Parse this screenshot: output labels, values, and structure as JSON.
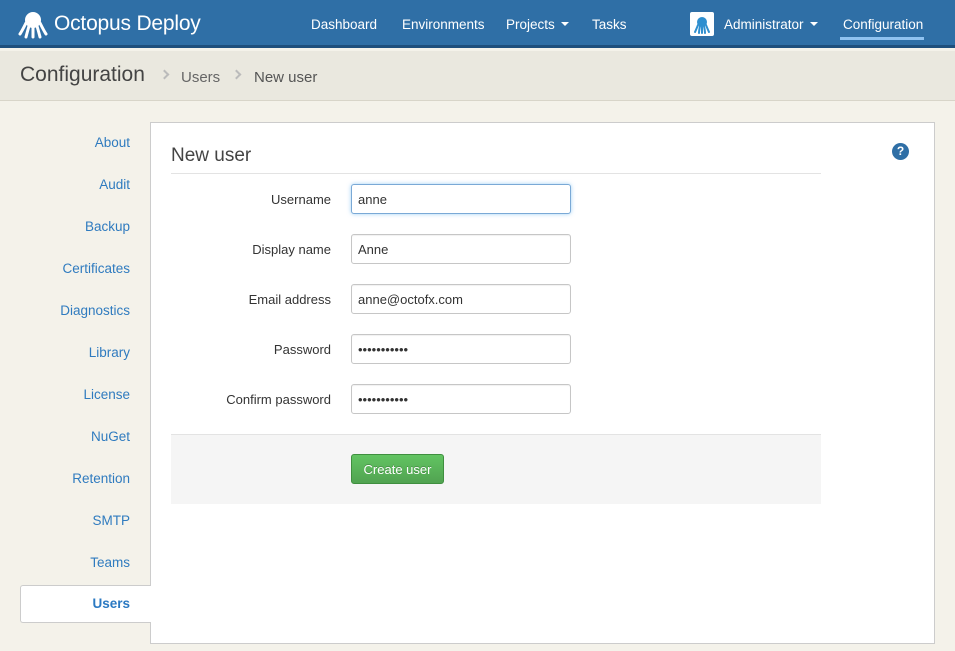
{
  "app": {
    "brand": "Octopus Deploy"
  },
  "nav": {
    "dashboard": "Dashboard",
    "environments": "Environments",
    "projects": "Projects",
    "tasks": "Tasks",
    "user": "Administrator",
    "configuration": "Configuration"
  },
  "breadcrumb": {
    "title": "Configuration",
    "users": "Users",
    "current": "New user"
  },
  "sidebar": {
    "items": [
      {
        "label": "About"
      },
      {
        "label": "Audit"
      },
      {
        "label": "Backup"
      },
      {
        "label": "Certificates"
      },
      {
        "label": "Diagnostics"
      },
      {
        "label": "Library"
      },
      {
        "label": "License"
      },
      {
        "label": "NuGet"
      },
      {
        "label": "Retention"
      },
      {
        "label": "SMTP"
      },
      {
        "label": "Teams"
      },
      {
        "label": "Users",
        "active": true
      }
    ]
  },
  "form": {
    "title": "New user",
    "help_icon": "?",
    "fields": [
      {
        "label": "Username",
        "value": "anne"
      },
      {
        "label": "Display name",
        "value": "Anne"
      },
      {
        "label": "Email address",
        "value": "anne@octofx.com"
      },
      {
        "label": "Password",
        "value": "•••••••••••"
      },
      {
        "label": "Confirm password",
        "value": "•••••••••••"
      }
    ],
    "submit_label": "Create user"
  },
  "colors": {
    "navbar": "#2f6fa6",
    "accent": "#2f7bbf",
    "success": "#5bb75b",
    "background": "#f4f2ea"
  }
}
